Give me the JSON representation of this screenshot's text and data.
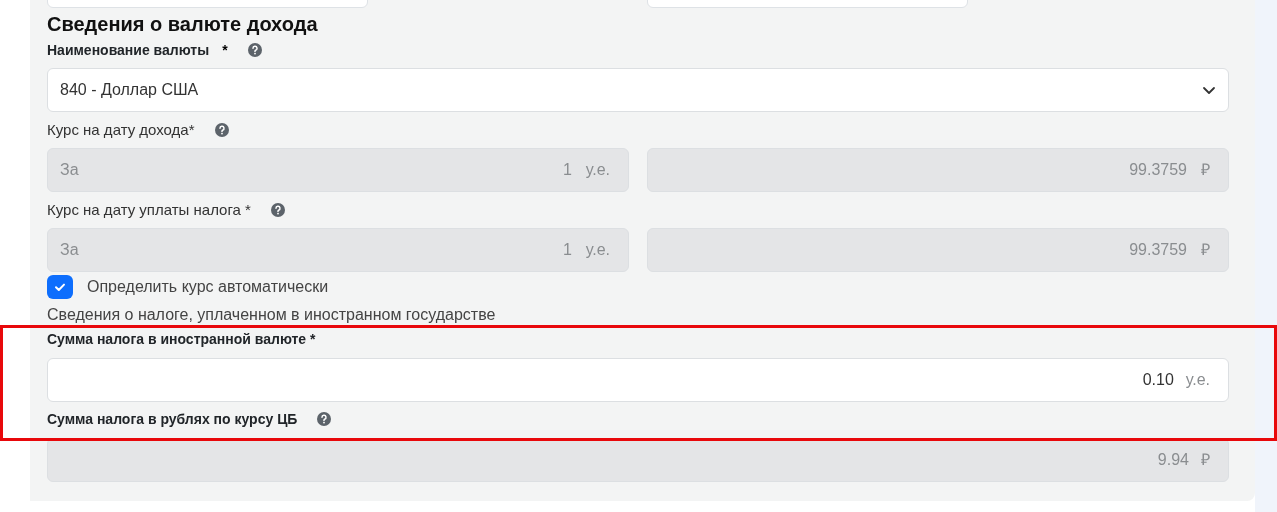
{
  "section_title": "Сведения о валюте дохода",
  "currency": {
    "label": "Наименование валюты",
    "required": "*",
    "help": true,
    "value": "840 - Доллар США"
  },
  "rates": [
    {
      "label": "Курс на дату дохода*",
      "help": true,
      "disabled": true,
      "left": {
        "prefix": "За",
        "value": "1",
        "unit": "у.е."
      },
      "right": {
        "value": "99.3759",
        "unit": "₽"
      }
    },
    {
      "label": "Курс на дату уплаты налога *",
      "help": true,
      "disabled": true,
      "left": {
        "prefix": "За",
        "value": "1",
        "unit": "у.е."
      },
      "right": {
        "value": "99.3759",
        "unit": "₽"
      }
    }
  ],
  "auto_rate": {
    "label": "Определить курс автоматически",
    "checked": true
  },
  "tax_section_title": "Сведения о налоге, уплаченном в иностранном государстве",
  "tax_fields": [
    {
      "label": "Сумма налога в иностранной валюте *",
      "help": false,
      "disabled": false,
      "value": "0.10",
      "unit": "у.е."
    },
    {
      "label": "Сумма налога в рублях по курсу ЦБ",
      "help": true,
      "disabled": true,
      "value": "9.94",
      "unit": "₽"
    }
  ],
  "highlight": true
}
